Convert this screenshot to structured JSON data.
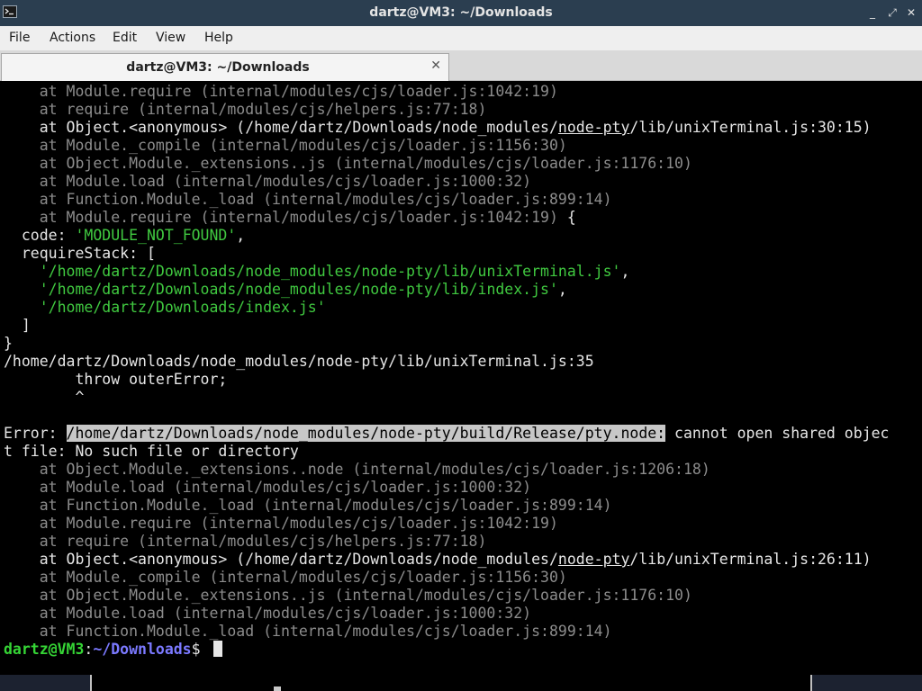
{
  "window": {
    "title": "dartz@VM3: ~/Downloads",
    "controls": {
      "minimize": "_",
      "maximize": "⤢",
      "close": "✕"
    }
  },
  "menu": {
    "items": [
      "File",
      "Actions",
      "Edit",
      "View",
      "Help"
    ]
  },
  "tab": {
    "label": "dartz@VM3: ~/Downloads",
    "close": "✕"
  },
  "colors": {
    "titlebar": "#2b3e50",
    "terminal_bg": "#000000",
    "dim_text": "#8c8c8c",
    "green_text": "#40c940",
    "prompt_user": "#35d435",
    "prompt_path": "#7b79ff"
  },
  "terminal": {
    "lines": [
      [
        {
          "t": "    at Module.require (internal/modules/cjs/loader.js:1042:19)",
          "c": "dim"
        }
      ],
      [
        {
          "t": "    at require (internal/modules/cjs/helpers.js:77:18)",
          "c": "dim"
        }
      ],
      [
        {
          "t": "    at Object.<anonymous> (/home/dartz/Downloads/node_modules/"
        },
        {
          "t": "node-pty",
          "c": "ul"
        },
        {
          "t": "/lib/unixTerminal.js:30:15)"
        }
      ],
      [
        {
          "t": "    at Module._compile (internal/modules/cjs/loader.js:1156:30)",
          "c": "dim"
        }
      ],
      [
        {
          "t": "    at Object.Module._extensions..js (internal/modules/cjs/loader.js:1176:10)",
          "c": "dim"
        }
      ],
      [
        {
          "t": "    at Module.load (internal/modules/cjs/loader.js:1000:32)",
          "c": "dim"
        }
      ],
      [
        {
          "t": "    at Function.Module._load (internal/modules/cjs/loader.js:899:14)",
          "c": "dim"
        }
      ],
      [
        {
          "t": "    at Module.require (internal/modules/cjs/loader.js:1042:19)",
          "c": "dim"
        },
        {
          "t": " {"
        }
      ],
      [
        {
          "t": "  code: "
        },
        {
          "t": "'MODULE_NOT_FOUND'",
          "c": "green"
        },
        {
          "t": ","
        }
      ],
      [
        {
          "t": "  requireStack: ["
        }
      ],
      [
        {
          "t": "    "
        },
        {
          "t": "'/home/dartz/Downloads/node_modules/node-pty/lib/unixTerminal.js'",
          "c": "green"
        },
        {
          "t": ","
        }
      ],
      [
        {
          "t": "    "
        },
        {
          "t": "'/home/dartz/Downloads/node_modules/node-pty/lib/index.js'",
          "c": "green"
        },
        {
          "t": ","
        }
      ],
      [
        {
          "t": "    "
        },
        {
          "t": "'/home/dartz/Downloads/index.js'",
          "c": "green"
        }
      ],
      [
        {
          "t": "  ]"
        }
      ],
      [
        {
          "t": "}"
        }
      ],
      [
        {
          "t": "/home/dartz/Downloads/node_modules/node-pty/lib/unixTerminal.js:35"
        }
      ],
      [
        {
          "t": "        throw outerError;"
        }
      ],
      [
        {
          "t": "        ^"
        }
      ],
      [
        {
          "t": ""
        }
      ],
      [
        {
          "t": "Error: "
        },
        {
          "t": "/home/dartz/Downloads/node_modules/node-pty/build/Release/pty.node:",
          "c": "hl"
        },
        {
          "t": " cannot open shared objec"
        }
      ],
      [
        {
          "t": "t file: No such file or directory"
        }
      ],
      [
        {
          "t": "    at Object.Module._extensions..node (internal/modules/cjs/loader.js:1206:18)",
          "c": "dim"
        }
      ],
      [
        {
          "t": "    at Module.load (internal/modules/cjs/loader.js:1000:32)",
          "c": "dim"
        }
      ],
      [
        {
          "t": "    at Function.Module._load (internal/modules/cjs/loader.js:899:14)",
          "c": "dim"
        }
      ],
      [
        {
          "t": "    at Module.require (internal/modules/cjs/loader.js:1042:19)",
          "c": "dim"
        }
      ],
      [
        {
          "t": "    at require (internal/modules/cjs/helpers.js:77:18)",
          "c": "dim"
        }
      ],
      [
        {
          "t": "    at Object.<anonymous> (/home/dartz/Downloads/node_modules/"
        },
        {
          "t": "node-pty",
          "c": "ul"
        },
        {
          "t": "/lib/unixTerminal.js:26:11)"
        }
      ],
      [
        {
          "t": "    at Module._compile (internal/modules/cjs/loader.js:1156:30)",
          "c": "dim"
        }
      ],
      [
        {
          "t": "    at Object.Module._extensions..js (internal/modules/cjs/loader.js:1176:10)",
          "c": "dim"
        }
      ],
      [
        {
          "t": "    at Module.load (internal/modules/cjs/loader.js:1000:32)",
          "c": "dim"
        }
      ],
      [
        {
          "t": "    at Function.Module._load (internal/modules/cjs/loader.js:899:14)",
          "c": "dim"
        }
      ]
    ],
    "prompt": {
      "user_host": "dartz@VM3",
      "separator": ":",
      "path": "~/Downloads",
      "symbol": "$ "
    }
  }
}
